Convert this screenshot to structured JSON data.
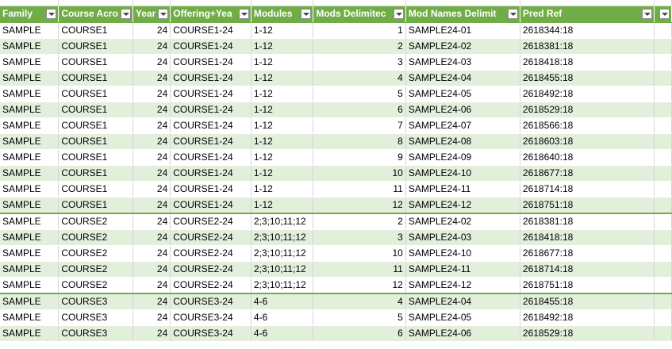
{
  "columns": [
    {
      "label": "Family"
    },
    {
      "label": "Course Acro"
    },
    {
      "label": "Year"
    },
    {
      "label": "Offering+Yea"
    },
    {
      "label": "Modules"
    },
    {
      "label": "Mods Delimitec"
    },
    {
      "label": "Mod Names Delimit"
    },
    {
      "label": "Pred Ref"
    },
    {
      "label": ""
    }
  ],
  "rows": [
    [
      "SAMPLE",
      "COURSE1",
      "24",
      "COURSE1-24",
      "1-12",
      "1",
      "SAMPLE24-01",
      "2618344:18"
    ],
    [
      "SAMPLE",
      "COURSE1",
      "24",
      "COURSE1-24",
      "1-12",
      "2",
      "SAMPLE24-02",
      "2618381:18"
    ],
    [
      "SAMPLE",
      "COURSE1",
      "24",
      "COURSE1-24",
      "1-12",
      "3",
      "SAMPLE24-03",
      "2618418:18"
    ],
    [
      "SAMPLE",
      "COURSE1",
      "24",
      "COURSE1-24",
      "1-12",
      "4",
      "SAMPLE24-04",
      "2618455:18"
    ],
    [
      "SAMPLE",
      "COURSE1",
      "24",
      "COURSE1-24",
      "1-12",
      "5",
      "SAMPLE24-05",
      "2618492:18"
    ],
    [
      "SAMPLE",
      "COURSE1",
      "24",
      "COURSE1-24",
      "1-12",
      "6",
      "SAMPLE24-06",
      "2618529:18"
    ],
    [
      "SAMPLE",
      "COURSE1",
      "24",
      "COURSE1-24",
      "1-12",
      "7",
      "SAMPLE24-07",
      "2618566:18"
    ],
    [
      "SAMPLE",
      "COURSE1",
      "24",
      "COURSE1-24",
      "1-12",
      "8",
      "SAMPLE24-08",
      "2618603:18"
    ],
    [
      "SAMPLE",
      "COURSE1",
      "24",
      "COURSE1-24",
      "1-12",
      "9",
      "SAMPLE24-09",
      "2618640:18"
    ],
    [
      "SAMPLE",
      "COURSE1",
      "24",
      "COURSE1-24",
      "1-12",
      "10",
      "SAMPLE24-10",
      "2618677:18"
    ],
    [
      "SAMPLE",
      "COURSE1",
      "24",
      "COURSE1-24",
      "1-12",
      "11",
      "SAMPLE24-11",
      "2618714:18"
    ],
    [
      "SAMPLE",
      "COURSE1",
      "24",
      "COURSE1-24",
      "1-12",
      "12",
      "SAMPLE24-12",
      "2618751:18"
    ],
    [
      "SAMPLE",
      "COURSE2",
      "24",
      "COURSE2-24",
      "2;3;10;11;12",
      "2",
      "SAMPLE24-02",
      "2618381:18"
    ],
    [
      "SAMPLE",
      "COURSE2",
      "24",
      "COURSE2-24",
      "2;3;10;11;12",
      "3",
      "SAMPLE24-03",
      "2618418:18"
    ],
    [
      "SAMPLE",
      "COURSE2",
      "24",
      "COURSE2-24",
      "2;3;10;11;12",
      "10",
      "SAMPLE24-10",
      "2618677:18"
    ],
    [
      "SAMPLE",
      "COURSE2",
      "24",
      "COURSE2-24",
      "2;3;10;11;12",
      "11",
      "SAMPLE24-11",
      "2618714:18"
    ],
    [
      "SAMPLE",
      "COURSE2",
      "24",
      "COURSE2-24",
      "2;3;10;11;12",
      "12",
      "SAMPLE24-12",
      "2618751:18"
    ],
    [
      "SAMPLE",
      "COURSE3",
      "24",
      "COURSE3-24",
      "4-6",
      "4",
      "SAMPLE24-04",
      "2618455:18"
    ],
    [
      "SAMPLE",
      "COURSE3",
      "24",
      "COURSE3-24",
      "4-6",
      "5",
      "SAMPLE24-05",
      "2618492:18"
    ],
    [
      "SAMPLE",
      "COURSE3",
      "24",
      "COURSE3-24",
      "4-6",
      "6",
      "SAMPLE24-06",
      "2618529:18"
    ]
  ],
  "group_starts": [
    12,
    17
  ],
  "numeric_columns": [
    2,
    5
  ],
  "colors": {
    "header": "#70ad47",
    "band": "#e2efda",
    "header_text": "#ffffff"
  }
}
